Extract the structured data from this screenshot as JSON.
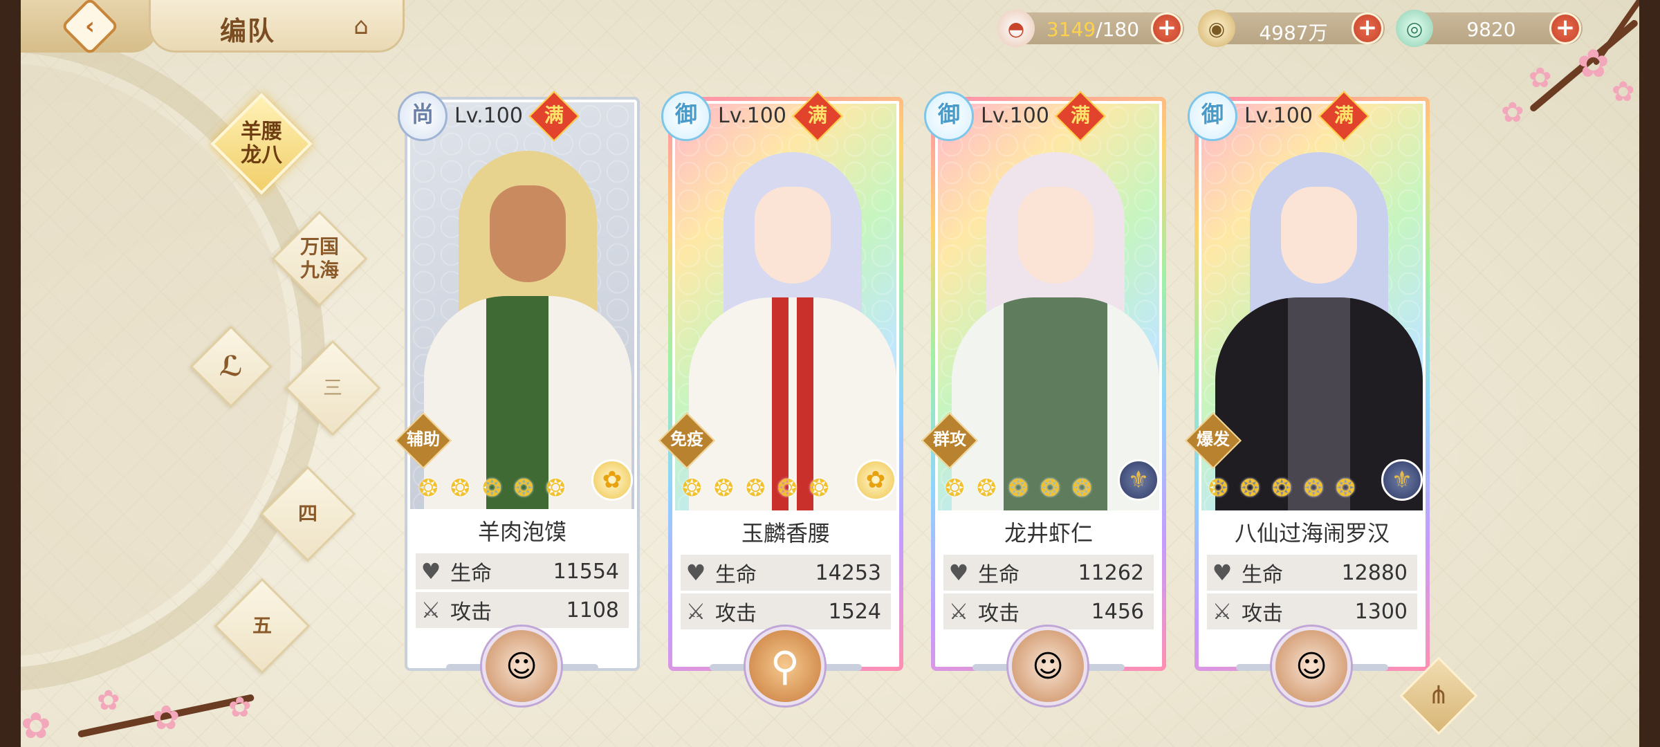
{
  "header": {
    "title": "编队",
    "resources": [
      {
        "icon": "food-bowl-icon",
        "current": "3149",
        "max": "/180"
      },
      {
        "icon": "coin-icon",
        "value": "4987万"
      },
      {
        "icon": "jade-icon",
        "value": "9820"
      }
    ],
    "add_label": "+"
  },
  "teams": [
    {
      "label": "羊腰\n龙八",
      "active": true
    },
    {
      "label": "万国\n九海",
      "active": false
    },
    {
      "label": "三",
      "active": false
    },
    {
      "label": "四",
      "active": false
    },
    {
      "label": "五",
      "active": false
    }
  ],
  "cards": [
    {
      "rank": "尚",
      "level": "Lv.100",
      "full": "满",
      "role": "辅助",
      "name": "羊肉泡馍",
      "stars": 5,
      "element": "gold",
      "hp_label": "生命",
      "hp": "11554",
      "atk_label": "攻击",
      "atk": "1108",
      "frame": "plain"
    },
    {
      "rank": "御",
      "level": "Lv.100",
      "full": "满",
      "role": "免疫",
      "name": "玉麟香腰",
      "stars": 5,
      "element": "gold",
      "hp_label": "生命",
      "hp": "14253",
      "atk_label": "攻击",
      "atk": "1524",
      "frame": "rainbow"
    },
    {
      "rank": "御",
      "level": "Lv.100",
      "full": "满",
      "role": "群攻",
      "name": "龙井虾仁",
      "stars": 5,
      "element": "blue",
      "hp_label": "生命",
      "hp": "11262",
      "atk_label": "攻击",
      "atk": "1456",
      "frame": "rainbow"
    },
    {
      "rank": "御",
      "level": "Lv.100",
      "full": "满",
      "role": "爆发",
      "name": "八仙过海闹罗汉",
      "stars": 5,
      "element": "blue",
      "hp_label": "生命",
      "hp": "12880",
      "atk_label": "攻击",
      "atk": "1300",
      "frame": "rainbow"
    }
  ],
  "colors": {
    "accent": "#c8452c",
    "gold": "#f2c12e",
    "brown": "#8b5a2b"
  }
}
